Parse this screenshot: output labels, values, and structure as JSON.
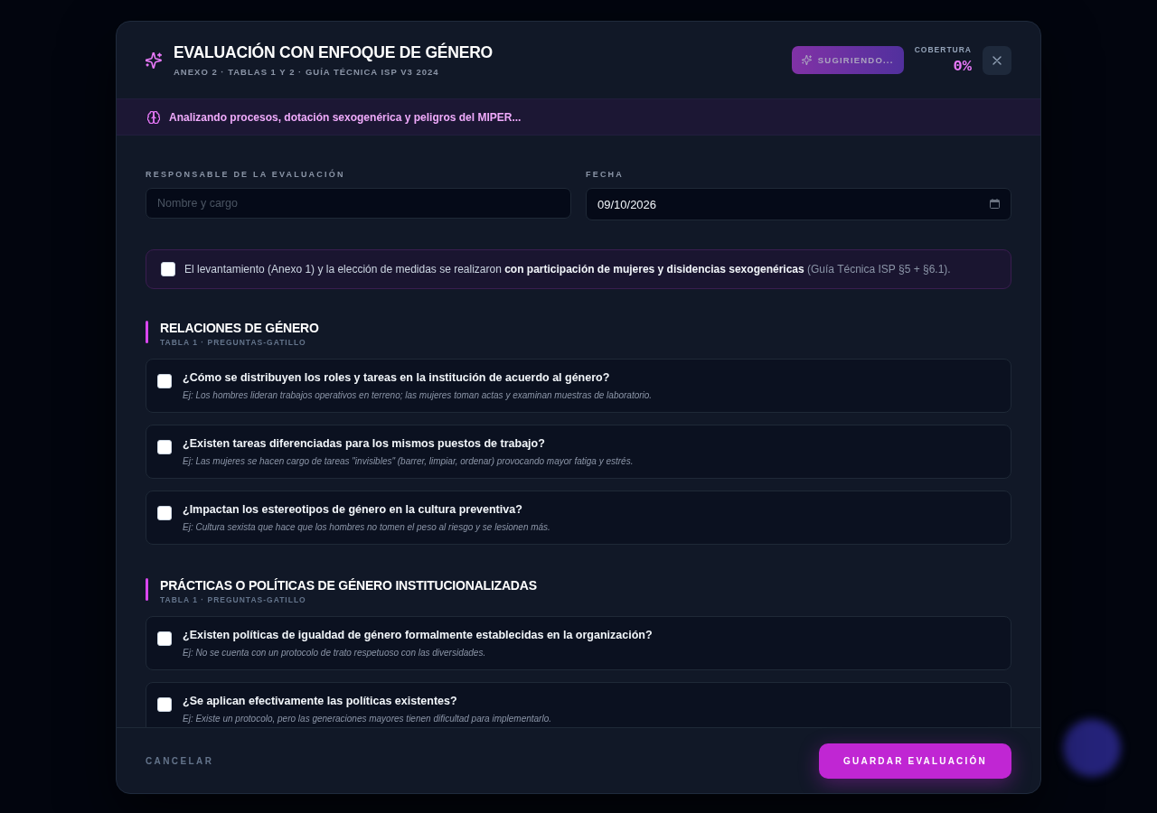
{
  "header": {
    "title": "EVALUACIÓN CON ENFOQUE DE GÉNERO",
    "subtitle": "ANEXO 2 · TABLAS 1 Y 2 · GUÍA TÉCNICA ISP V3 2024",
    "suggest_button": {
      "label": "SUGIRIENDO...",
      "disabled": true
    },
    "coverage": {
      "label": "COBERTURA",
      "value": "0%"
    }
  },
  "status_banner": {
    "text": "Analizando procesos, dotación sexogenérica y peligros del MIPER..."
  },
  "fields": [
    {
      "kind": "text",
      "label": "RESPONSABLE DE LA EVALUACIÓN",
      "placeholder": "Nombre y cargo"
    },
    {
      "kind": "date",
      "label": "FECHA",
      "value": "09/10/2026"
    }
  ],
  "participation": {
    "checked": false,
    "text": "El levantamiento (Anexo 1) y la elección de medidas se realizaron **con participación de mujeres y disidencias sexogenéricas**",
    "note": "(Guía Técnica ISP §5 + §6.1)."
  },
  "sections": [
    {
      "title": "RELACIONES DE GÉNERO",
      "subtitle": "TABLA 1 · PREGUNTAS-GATILLO",
      "questions": [
        {
          "checked": false,
          "question": "¿Cómo se distribuyen los roles y tareas en la institución de acuerdo al género?",
          "example": "Ej: Los hombres lideran trabajos operativos en terreno; las mujeres toman actas y examinan muestras de laboratorio."
        },
        {
          "checked": false,
          "question": "¿Existen tareas diferenciadas para los mismos puestos de trabajo?",
          "example": "Ej: Las mujeres se hacen cargo de tareas \"invisibles\" (barrer, limpiar, ordenar) provocando mayor fatiga y estrés."
        },
        {
          "checked": false,
          "question": "¿Impactan los estereotipos de género en la cultura preventiva?",
          "example": "Ej: Cultura sexista que hace que los hombres no tomen el peso al riesgo y se lesionen más."
        }
      ]
    },
    {
      "title": "PRÁCTICAS O POLÍTICAS DE GÉNERO INSTITUCIONALIZADAS",
      "subtitle": "TABLA 1 · PREGUNTAS-GATILLO",
      "questions": [
        {
          "checked": false,
          "question": "¿Existen políticas de igualdad de género formalmente establecidas en la organización?",
          "example": "Ej: No se cuenta con un protocolo de trato respetuoso con las diversidades."
        },
        {
          "checked": false,
          "question": "¿Se aplican efectivamente las políticas existentes?",
          "example": "Ej: Existe un protocolo, pero las generaciones mayores tienen dificultad para implementarlo."
        }
      ]
    }
  ],
  "footer": {
    "cancel": "CANCELAR",
    "save": "GUARDAR EVALUACIÓN"
  }
}
